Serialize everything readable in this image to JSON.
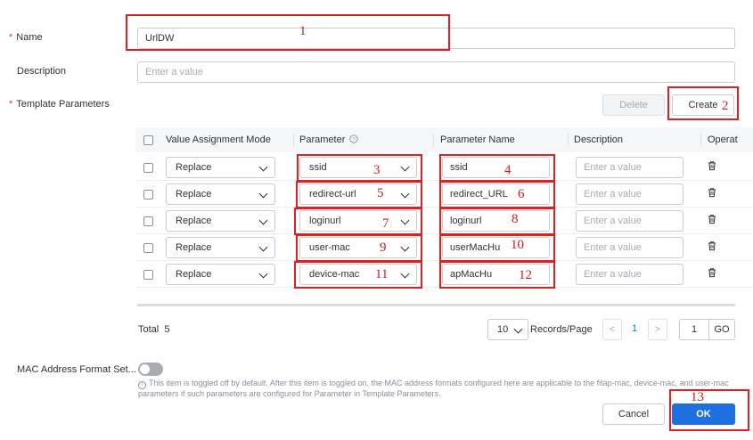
{
  "form": {
    "name_label": "Name",
    "name_value": "UrlDW",
    "description_label": "Description",
    "description_placeholder": "Enter a value",
    "template_params_label": "Template Parameters",
    "delete_label": "Delete",
    "create_label": "Create",
    "mac_format_label": "MAC Address Format Set...",
    "mac_format_enabled": false,
    "mac_hint": "This item is toggled off by default. After this item is toggled on, the MAC address formats configured here are applicable to the fitap-mac, device-mac, and user-mac parameters if such parameters are configured for Parameter in Template Parameters.",
    "cancel_label": "Cancel",
    "ok_label": "OK"
  },
  "table": {
    "headers": {
      "mode": "Value Assignment Mode",
      "parameter": "Parameter",
      "parameter_name": "Parameter Name",
      "description": "Description",
      "operation": "Operat"
    },
    "rows": [
      {
        "mode": "Replace",
        "parameter": "ssid",
        "parameter_name": "ssid",
        "description_placeholder": "Enter a value"
      },
      {
        "mode": "Replace",
        "parameter": "redirect-url",
        "parameter_name": "redirect_URL",
        "description_placeholder": "Enter a value"
      },
      {
        "mode": "Replace",
        "parameter": "loginurl",
        "parameter_name": "loginurl",
        "description_placeholder": "Enter a value"
      },
      {
        "mode": "Replace",
        "parameter": "user-mac",
        "parameter_name": "userMacHu",
        "description_placeholder": "Enter a value"
      },
      {
        "mode": "Replace",
        "parameter": "device-mac",
        "parameter_name": "apMacHu",
        "description_placeholder": "Enter a value"
      }
    ]
  },
  "pagination": {
    "total_label": "Total",
    "total": "5",
    "page_size": "10",
    "records_label": "Records/Page",
    "prev": "<",
    "current_page": "1",
    "next": ">",
    "goto_value": "1",
    "go_label": "GO"
  },
  "annotations": [
    "1",
    "2",
    "3",
    "4",
    "5",
    "6",
    "7",
    "8",
    "9",
    "10",
    "11",
    "12",
    "13"
  ],
  "colors": {
    "accent": "#1e6fe0",
    "annotation": "#e02020",
    "required": "#e53935"
  }
}
